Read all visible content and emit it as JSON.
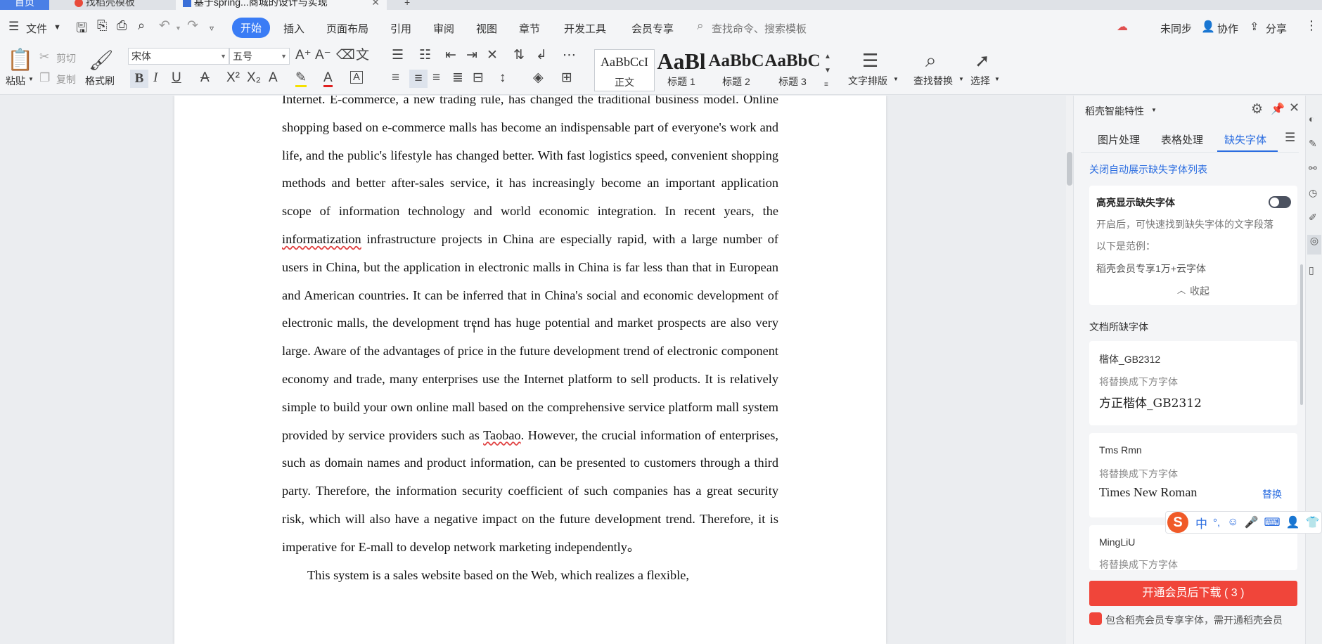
{
  "tabs": {
    "home": "首页",
    "template": "找稻壳模板",
    "document": "基于spring...商城的设计与实现",
    "add": "+"
  },
  "menu": {
    "file": "文件",
    "items": [
      "开始",
      "插入",
      "页面布局",
      "引用",
      "审阅",
      "视图",
      "章节",
      "开发工具",
      "会员专享"
    ],
    "search_placeholder": "查找命令、搜索模板",
    "sync": "未同步",
    "collab": "协作",
    "share": "分享"
  },
  "ribbon": {
    "paste": "粘贴",
    "cut": "剪切",
    "copy": "复制",
    "format_painter": "格式刷",
    "font_name": "宋体",
    "font_size": "五号",
    "styles": [
      {
        "preview": "AaBbCcI",
        "label": "正文"
      },
      {
        "preview": "AaBl",
        "label": "标题 1"
      },
      {
        "preview": "AaBbC",
        "label": "标题 2"
      },
      {
        "preview": "AaBbC",
        "label": "标题 3"
      }
    ],
    "text_layout": "文字排版",
    "find_replace": "查找替换",
    "select": "选择"
  },
  "document": {
    "paragraph1_lines": [
      "Internet. E-commerce, a new trading rule, has changed the traditional business model. Online shopping based on e-commerce malls has become an indispensable part of everyone's work and life, and the public's lifestyle has changed better. With fast logistics speed, convenient shopping methods and better after-sales service, it has increasingly become an important application scope of information technology and world economic integration. In recent years, the ",
      "informatization",
      " infrastructure projects in China are especially rapid, with a large number of users in China, but the application in electronic malls in China is far less than that in European and American countries. It can be inferred that in China's social and economic development of electronic malls, the development trend has huge potential and market prospects are also very large. Aware of the advantages of price in the future development trend of electronic component economy and trade, many enterprises use the Internet platform to sell products. It is relatively simple to build your own online mall based on the comprehensive service platform mall system provided by service providers such as ",
      "Taobao",
      ". However, the crucial information of enterprises, such as domain names and product information, can be presented to customers through a third party. Therefore, the information security coefficient of such companies has a great security risk, which will also have a negative impact on the future development trend. Therefore, it is imperative for E-mall to develop network marketing independently。"
    ],
    "paragraph2": "This system is a sales website based on the Web, which realizes a flexible,"
  },
  "panel": {
    "title": "稻壳智能特性",
    "tabs": [
      "图片处理",
      "表格处理",
      "缺失字体"
    ],
    "close_auto": "关闭自动展示缺失字体列表",
    "highlight_title": "高亮显示缺失字体",
    "highlight_desc": "开启后，可快速找到缺失字体的文字段落",
    "example_label": "以下是范例：",
    "example_text": "稻壳会员专享1万+云字体",
    "collapse": "收起",
    "missing_section": "文档所缺字体",
    "fonts": [
      {
        "name": "楷体_GB2312",
        "hint": "将替换成下方字体",
        "replacement": "方正楷体_GB2312",
        "action": ""
      },
      {
        "name": "Tms Rmn",
        "hint": "将替换成下方字体",
        "replacement": "Times New Roman",
        "action": "替换"
      },
      {
        "name": "MingLiU",
        "hint": "将替换成下方字体",
        "replacement": "",
        "action": ""
      }
    ],
    "download_button": "开通会员后下载 ( 3 )",
    "footer_note": "包含稻壳会员专享字体，需开通稻壳会员"
  },
  "ime": {
    "lang": "中",
    "punct": "°,"
  },
  "colors": {
    "accent": "#2b6de0",
    "download": "#f0453a",
    "active_tab": "#3a7cf5"
  }
}
